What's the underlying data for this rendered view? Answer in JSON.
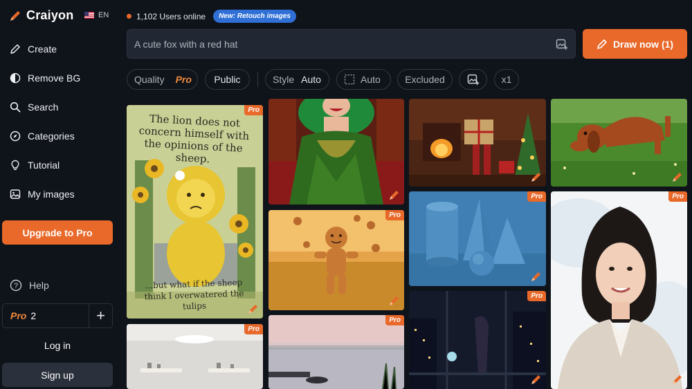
{
  "brand": {
    "name": "Craiyon",
    "language": "EN"
  },
  "sidebar": {
    "items": [
      {
        "label": "Create",
        "icon": "pencil-icon"
      },
      {
        "label": "Remove BG",
        "icon": "half-circle-icon"
      },
      {
        "label": "Search",
        "icon": "search-icon"
      },
      {
        "label": "Categories",
        "icon": "compass-icon"
      },
      {
        "label": "Tutorial",
        "icon": "lightbulb-icon"
      },
      {
        "label": "My images",
        "icon": "image-icon"
      }
    ],
    "upgrade_label": "Upgrade to Pro",
    "help_label": "Help",
    "pro_label": "Pro",
    "pro_count": "2",
    "plus_label": "+",
    "login_label": "Log in",
    "signup_label": "Sign up"
  },
  "header": {
    "users_online": "1,102 Users online",
    "new_badge": "New: Retouch images"
  },
  "prompt": {
    "placeholder": "A cute fox with a red hat",
    "draw_label": "Draw now (1)"
  },
  "options": {
    "quality_label": "Quality",
    "quality_value": "Pro",
    "visibility": "Public",
    "style_label": "Style",
    "style_value": "Auto",
    "aspect_value": "Auto",
    "excluded_label": "Excluded",
    "count_value": "x1"
  },
  "gallery": {
    "pro_tag": "Pro",
    "lion_quote_top": "The lion does not concern himself with the opinions of the sheep.",
    "lion_quote_bottom": "...but what if the sheep think I overwatered the tulips"
  },
  "colors": {
    "accent": "#e8692a",
    "background": "#0f131a",
    "badge_blue": "#2f6fd6"
  }
}
